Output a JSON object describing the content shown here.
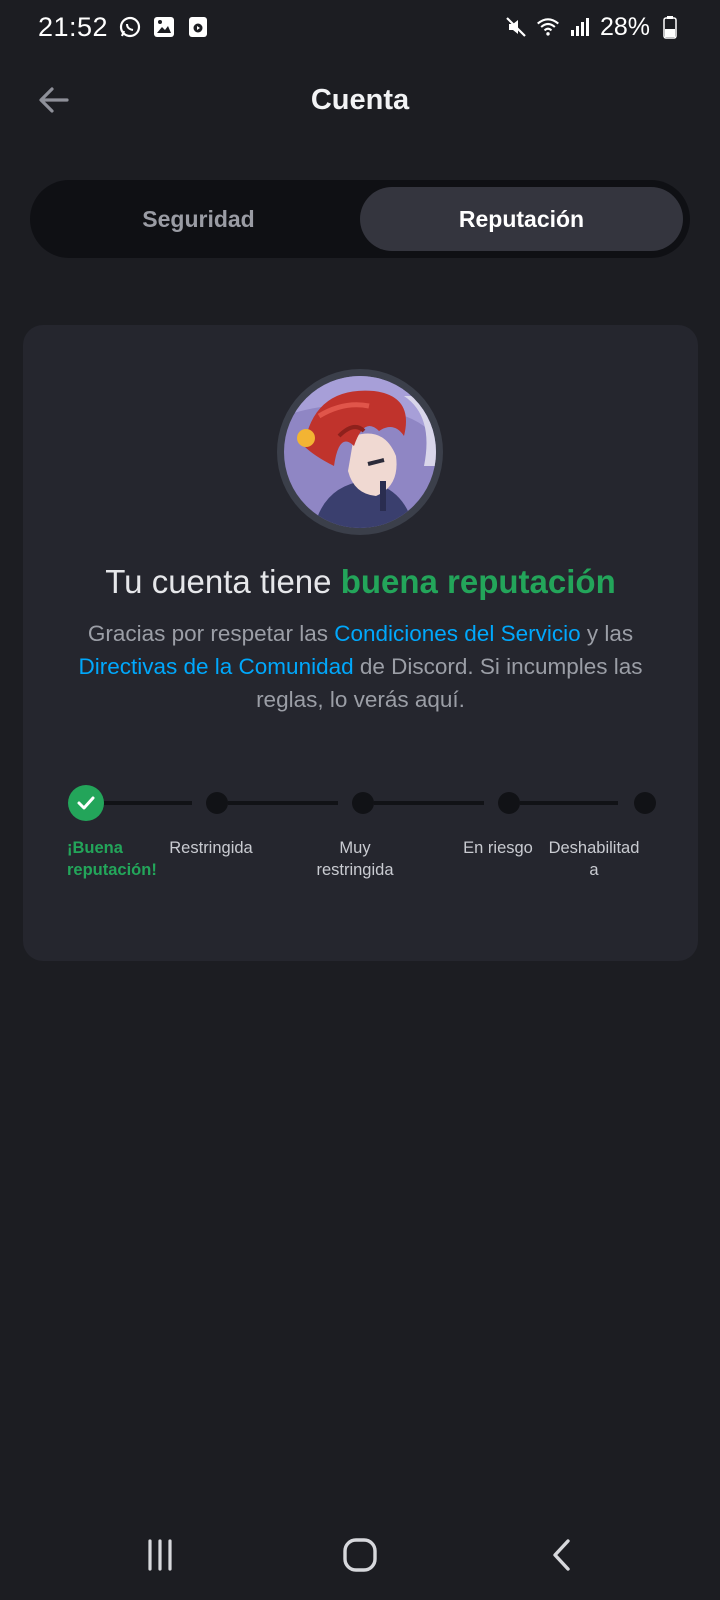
{
  "status_bar": {
    "time": "21:52",
    "battery": "28%",
    "left_icons": [
      "whatsapp-icon",
      "gallery-icon",
      "media-icon"
    ],
    "right_icons": [
      "mute-icon",
      "wifi-icon",
      "signal-icon",
      "battery-icon"
    ]
  },
  "header": {
    "title": "Cuenta",
    "back_icon": "arrow-left-icon"
  },
  "tabs": [
    {
      "label": "Seguridad",
      "active": false
    },
    {
      "label": "Reputación",
      "active": true
    }
  ],
  "standing": {
    "heading_prefix": "Tu cuenta tiene ",
    "heading_status": "buena reputación",
    "desc_part1": "Gracias por respetar las ",
    "desc_link1": "Condiciones del Servicio",
    "desc_part2": " y las ",
    "desc_link2": "Directivas de la Comunidad",
    "desc_part3": " de Discord. Si incumples las reglas, lo verás aquí."
  },
  "steps": [
    {
      "label_line1": "¡Buena",
      "label_line2": "reputación!",
      "current": true
    },
    {
      "label_line1": "Restringida",
      "label_line2": "",
      "current": false
    },
    {
      "label_line1": "Muy",
      "label_line2": "restringida",
      "current": false
    },
    {
      "label_line1": "En riesgo",
      "label_line2": "",
      "current": false
    },
    {
      "label_line1": "Deshabilitad",
      "label_line2": "a",
      "current": false
    }
  ],
  "colors": {
    "background": "#1c1d22",
    "card": "#25262e",
    "accent_green": "#23a55a",
    "link_blue": "#00a8fc"
  },
  "navbar": [
    "recents-icon",
    "home-icon",
    "back-icon"
  ]
}
